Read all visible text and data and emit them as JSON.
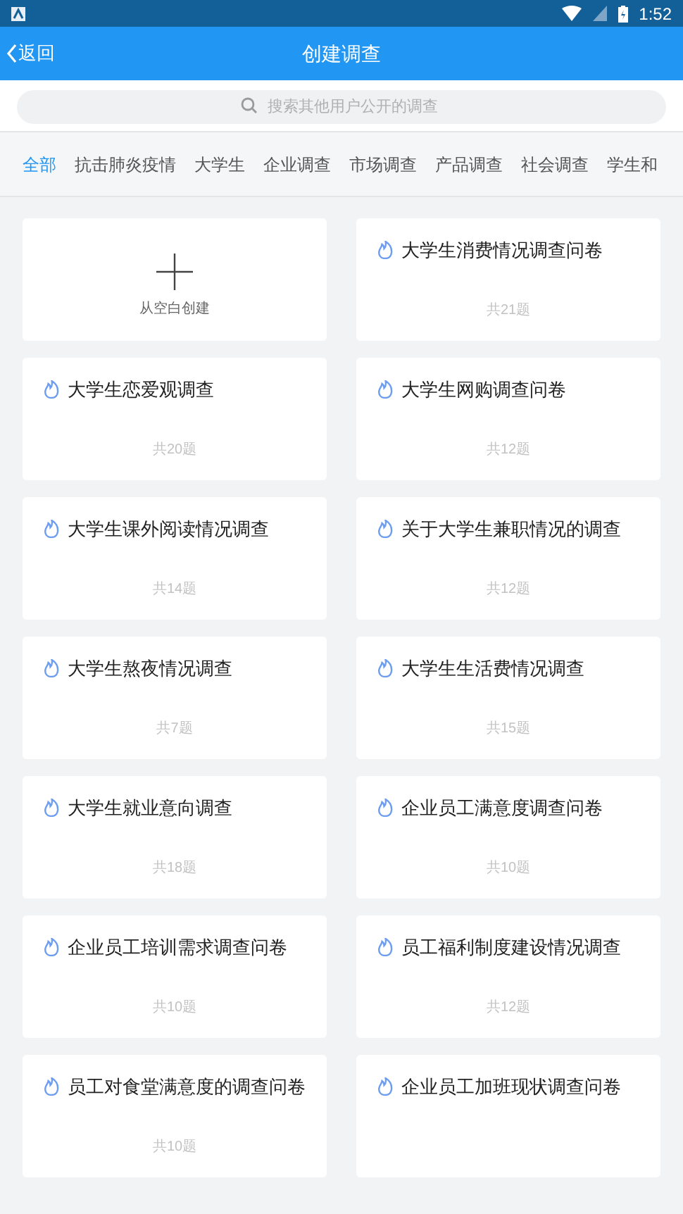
{
  "status_bar": {
    "time": "1:52"
  },
  "header": {
    "back": "返回",
    "title": "创建调查"
  },
  "search": {
    "placeholder": "搜索其他用户公开的调查"
  },
  "tabs": [
    {
      "label": "全部",
      "selected": true
    },
    {
      "label": "抗击肺炎疫情",
      "selected": false
    },
    {
      "label": "大学生",
      "selected": false
    },
    {
      "label": "企业调查",
      "selected": false
    },
    {
      "label": "市场调查",
      "selected": false
    },
    {
      "label": "产品调查",
      "selected": false
    },
    {
      "label": "社会调查",
      "selected": false
    },
    {
      "label": "学生和",
      "selected": false
    }
  ],
  "cards": [
    {
      "kind": "create",
      "label": "从空白创建"
    },
    {
      "kind": "template",
      "title": "大学生消费情况调查问卷",
      "count": "共21题"
    },
    {
      "kind": "template",
      "title": "大学生恋爱观调查",
      "count": "共20题"
    },
    {
      "kind": "template",
      "title": "大学生网购调查问卷",
      "count": "共12题"
    },
    {
      "kind": "template",
      "title": "大学生课外阅读情况调查",
      "count": "共14题"
    },
    {
      "kind": "template",
      "title": "关于大学生兼职情况的调查",
      "count": "共12题"
    },
    {
      "kind": "template",
      "title": "大学生熬夜情况调查",
      "count": "共7题"
    },
    {
      "kind": "template",
      "title": "大学生生活费情况调查",
      "count": "共15题"
    },
    {
      "kind": "template",
      "title": "大学生就业意向调查",
      "count": "共18题"
    },
    {
      "kind": "template",
      "title": "企业员工满意度调查问卷",
      "count": "共10题"
    },
    {
      "kind": "template",
      "title": "企业员工培训需求调查问卷",
      "count": "共10题"
    },
    {
      "kind": "template",
      "title": "员工福利制度建设情况调查",
      "count": "共12题"
    },
    {
      "kind": "template",
      "title": "员工对食堂满意度的调查问卷",
      "count": "共10题"
    },
    {
      "kind": "template",
      "title": "企业员工加班现状调查问卷"
    }
  ]
}
